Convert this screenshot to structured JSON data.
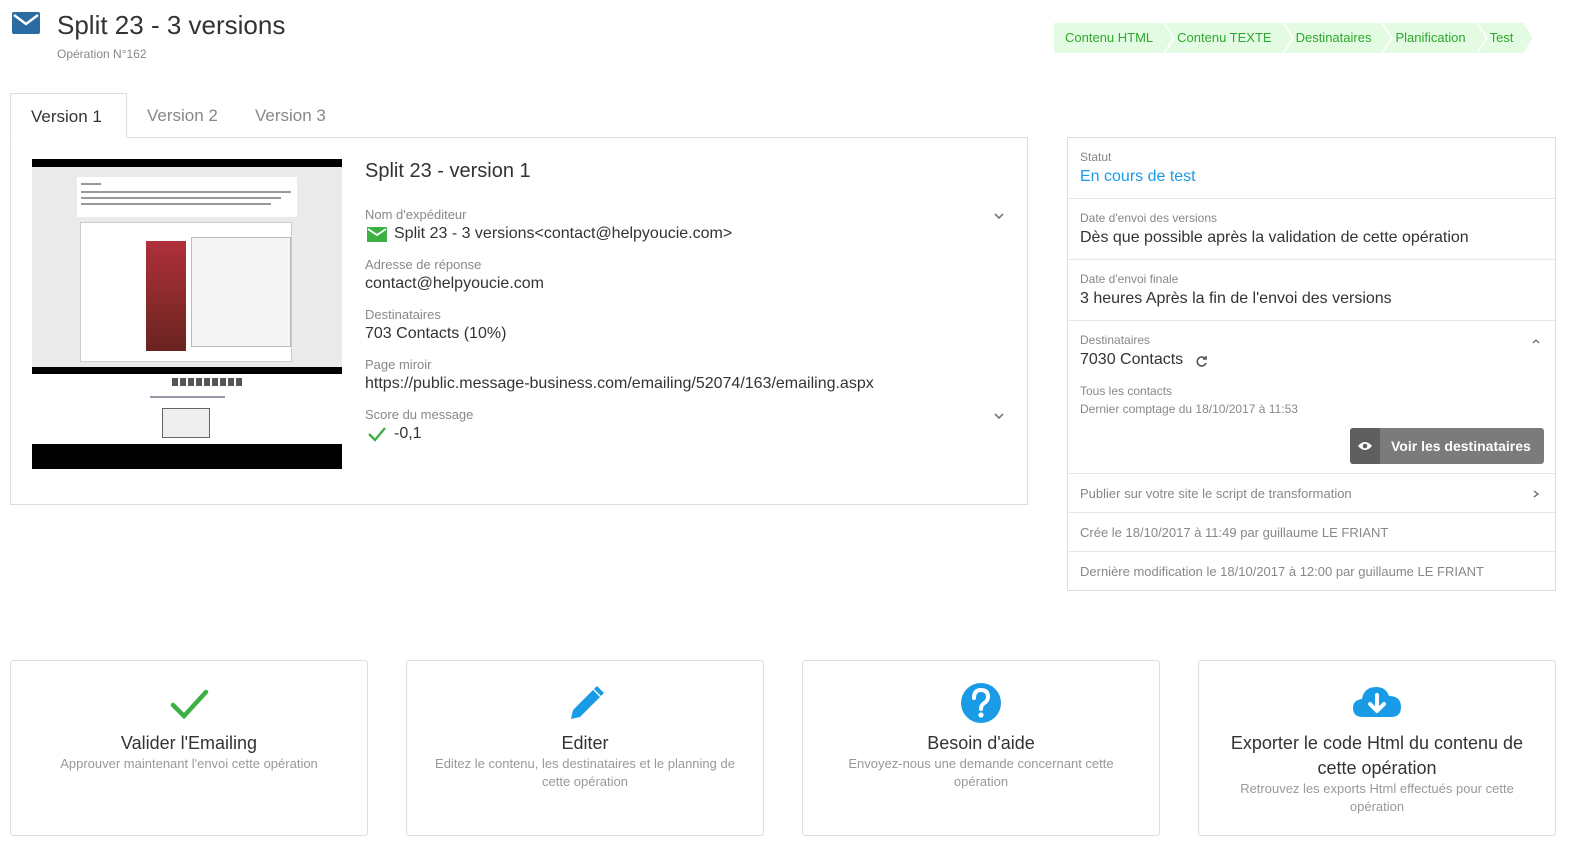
{
  "header": {
    "title": "Split 23 - 3 versions",
    "subtitle": "Opération N°162",
    "steps": [
      "Contenu HTML",
      "Contenu TEXTE",
      "Destinataires",
      "Planification",
      "Test"
    ]
  },
  "tabs": [
    "Version 1",
    "Version 2",
    "Version 3"
  ],
  "version": {
    "title": "Split 23 - version 1",
    "sender_label": "Nom d'expéditeur",
    "sender_value": "Split 23 - 3 versions<contact@helpyoucie.com>",
    "reply_label": "Adresse de réponse",
    "reply_value": "contact@helpyoucie.com",
    "recipients_label": "Destinataires",
    "recipients_value": "703 Contacts (10%)",
    "mirror_label": "Page miroir",
    "mirror_value": "https://public.message-business.com/emailing/52074/163/emailing.aspx",
    "score_label": "Score du message",
    "score_value": "-0,1"
  },
  "side": {
    "status_label": "Statut",
    "status_value": "En cours de test",
    "send_date_label": "Date d'envoi des versions",
    "send_date_value": "Dès que possible après la validation de cette opération",
    "final_date_label": "Date d'envoi finale",
    "final_date_value": "3 heures Après la fin de l'envoi des versions",
    "dest_label": "Destinataires",
    "dest_value": "7030 Contacts",
    "dest_all": "Tous les contacts",
    "dest_count_date": "Dernier comptage du 18/10/2017 à 11:53",
    "voir_button": "Voir les destinataires",
    "publish_link": "Publier sur votre site le script de transformation",
    "created": "Crée le 18/10/2017 à 11:49 par guillaume LE FRIANT",
    "modified": "Dernière modification le 18/10/2017 à 12:00 par guillaume LE FRIANT"
  },
  "cards": [
    {
      "title": "Valider l'Emailing",
      "desc": "Approuver maintenant l'envoi cette opération",
      "icon": "check-icon"
    },
    {
      "title": "Editer",
      "desc": "Editez le contenu, les destinataires et le planning de cette opération",
      "icon": "pencil-icon"
    },
    {
      "title": "Besoin d'aide",
      "desc": "Envoyez-nous une demande concernant cette opération",
      "icon": "help-icon"
    },
    {
      "title": "Exporter le code Html du contenu de cette opération",
      "desc": "Retrouvez les exports Html effectués pour cette opération",
      "icon": "cloud-download-icon"
    }
  ],
  "colors": {
    "accent_blue": "#1a9be6",
    "success_green": "#2ea82e",
    "step_bg": "#e3fbe3"
  }
}
